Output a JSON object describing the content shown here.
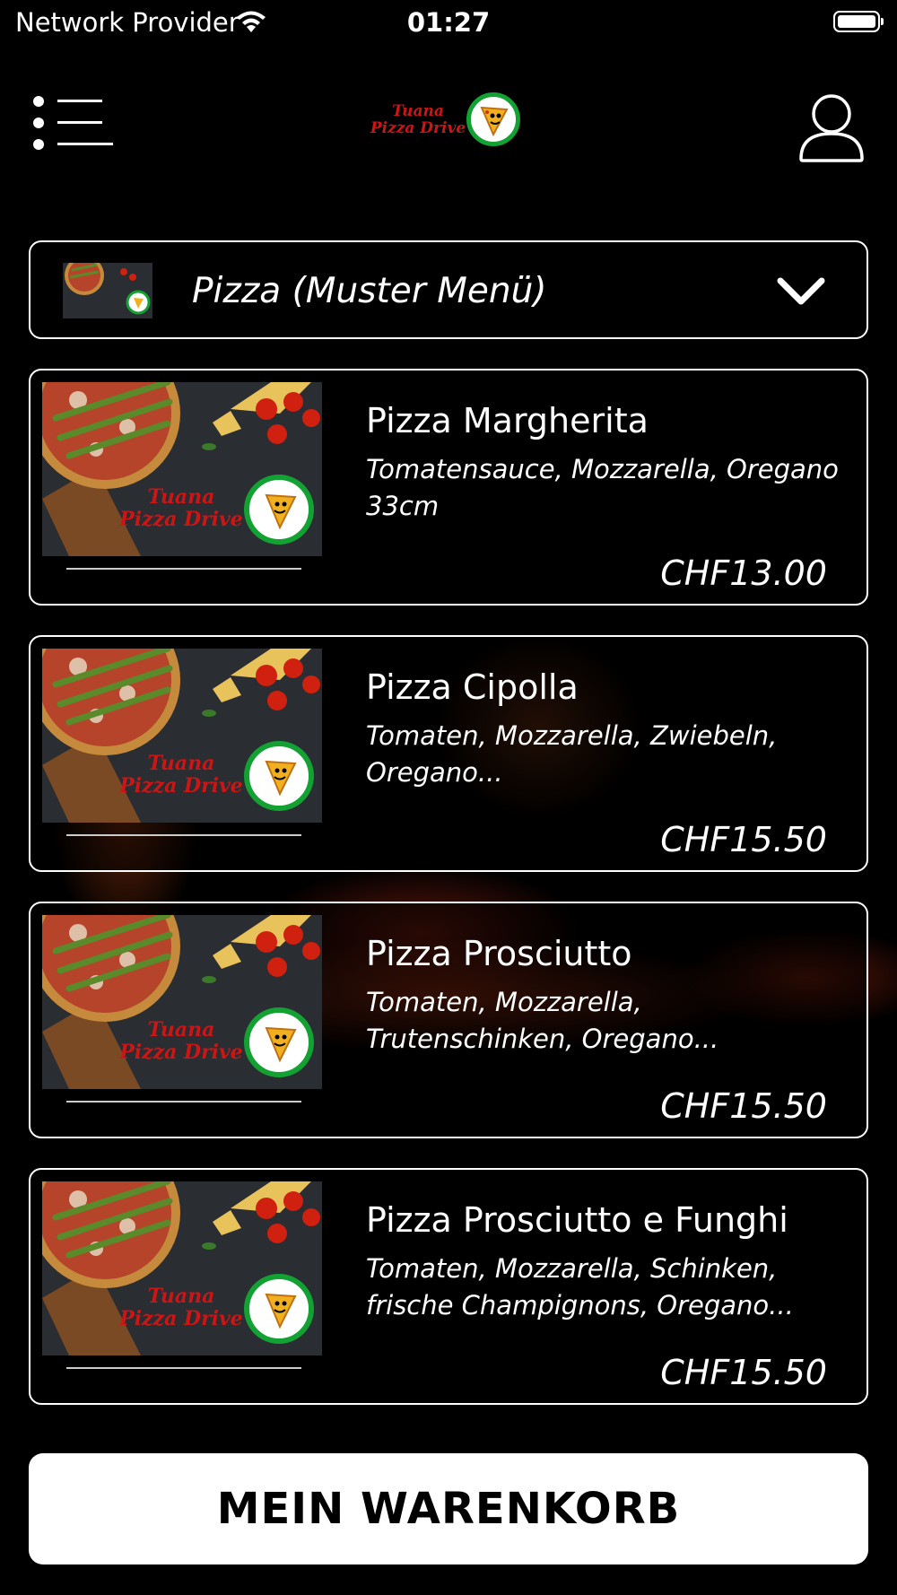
{
  "status_bar": {
    "carrier": "Network Provider",
    "time": "01:27"
  },
  "header": {
    "logo_line1": "Tuana",
    "logo_line2": "Pizza Drive",
    "menu_icon": "hamburger-menu-icon",
    "profile_icon": "user-profile-icon"
  },
  "category": {
    "label": "Pizza (Muster Menü)",
    "chevron_icon": "chevron-down-icon"
  },
  "products": [
    {
      "title": "Pizza Margherita",
      "description": "Tomatensauce, Mozzarella, Oregano 33cm",
      "price": "CHF13.00"
    },
    {
      "title": "Pizza Cipolla",
      "description": "Tomaten, Mozzarella, Zwiebeln, Oregano...",
      "price": "CHF15.50"
    },
    {
      "title": "Pizza Prosciutto",
      "description": "Tomaten, Mozzarella, Trutenschinken, Oregano...",
      "price": "CHF15.50"
    },
    {
      "title": "Pizza Prosciutto e Funghi",
      "description": "Tomaten, Mozzarella, Schinken, frische Champignons, Oregano...",
      "price": "CHF15.50"
    }
  ],
  "cart": {
    "label": "MEIN WARENKORB"
  },
  "colors": {
    "background": "#000000",
    "logo_red": "#cc1515",
    "logo_green": "#12a132",
    "cart_button": "#ffffff"
  }
}
